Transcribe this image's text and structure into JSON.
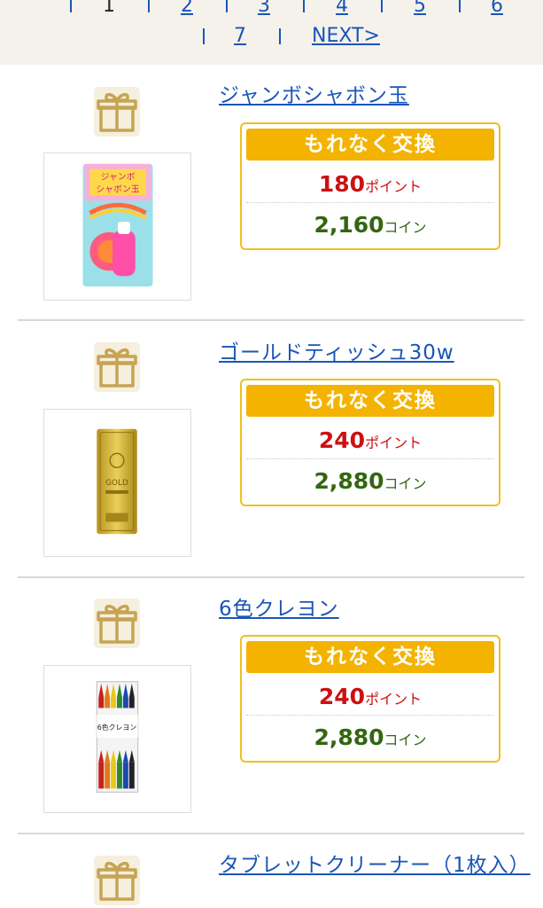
{
  "pager": {
    "pages": [
      "1",
      "2",
      "3",
      "4",
      "5",
      "6",
      "7"
    ],
    "next_label": "NEXT>"
  },
  "colors": {
    "link": "#1a55b8",
    "badge_gold": "#f3b300",
    "points_red": "#cc1111",
    "coins_green": "#336611"
  },
  "items": [
    {
      "title": "ジャンボシャボン玉",
      "icon": "gift-icon",
      "badge": "もれなく交換",
      "points": "180",
      "points_unit": "ポイント",
      "coins": "2,160",
      "coins_unit": "コイン",
      "image_text": [
        "ジャンボ",
        "シャボン玉"
      ]
    },
    {
      "title": "ゴールドティッシュ30w",
      "icon": "gift-icon",
      "badge": "もれなく交換",
      "points": "240",
      "points_unit": "ポイント",
      "coins": "2,880",
      "coins_unit": "コイン",
      "image_text": [
        "GOLD"
      ]
    },
    {
      "title": "6色クレヨン",
      "icon": "gift-icon",
      "badge": "もれなく交換",
      "points": "240",
      "points_unit": "ポイント",
      "coins": "2,880",
      "coins_unit": "コイン",
      "image_text": [
        "6色クレヨン"
      ]
    },
    {
      "title": "タブレットクリーナー（1枚入）",
      "icon": "gift-icon"
    }
  ]
}
